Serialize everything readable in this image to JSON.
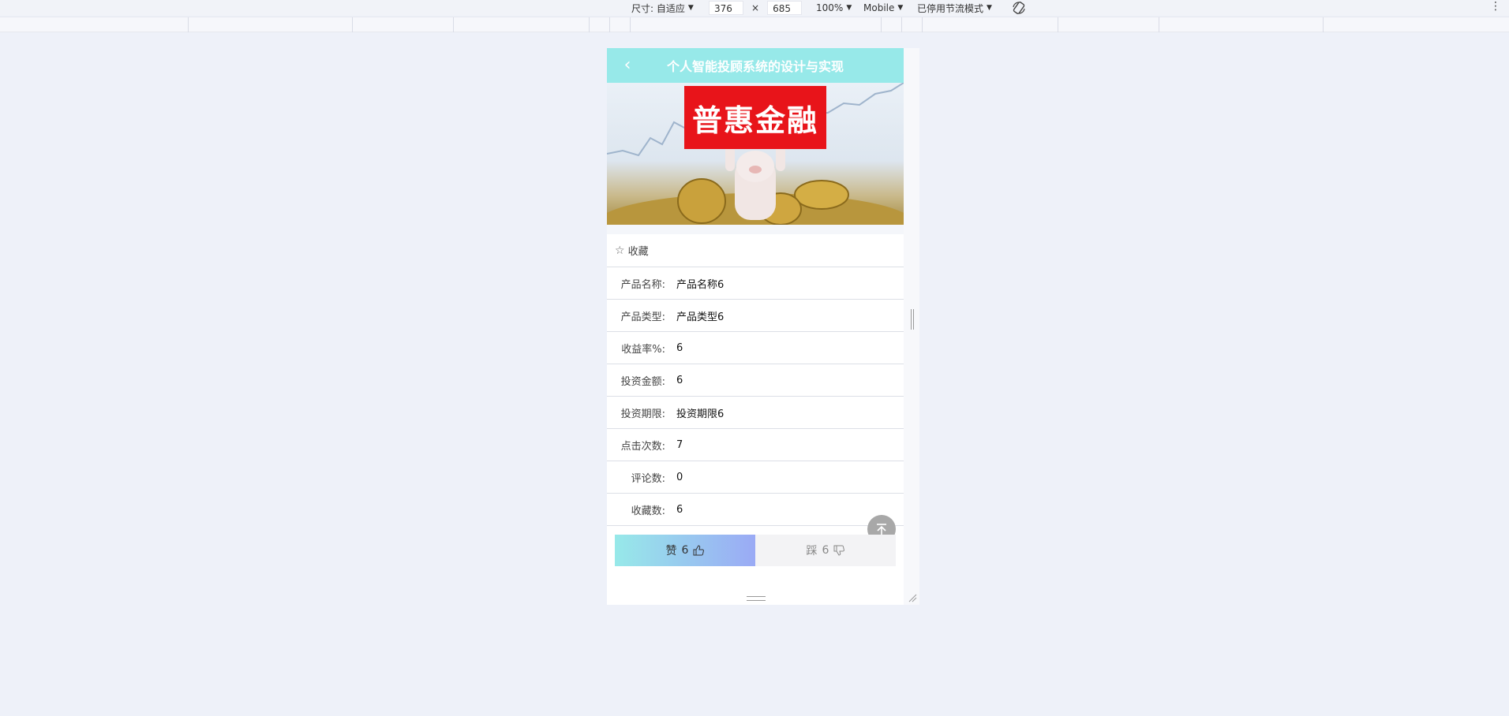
{
  "devtools": {
    "size_label": "尺寸: 自适应",
    "width": "376",
    "times": "×",
    "height": "685",
    "zoom": "100%",
    "device": "Mobile",
    "throttle": "已停用节流模式",
    "menu": "⋮"
  },
  "header": {
    "back_glyph": "‹",
    "title": "个人智能投顾系统的设计与实现"
  },
  "banner": {
    "sign_text": "普惠金融"
  },
  "favorite": {
    "star": "☆",
    "label": "收藏"
  },
  "details": [
    {
      "label": "产品名称:",
      "value": "产品名称6"
    },
    {
      "label": "产品类型:",
      "value": "产品类型6"
    },
    {
      "label": "收益率%:",
      "value": "6"
    },
    {
      "label": "投资金额:",
      "value": "6"
    },
    {
      "label": "投资期限:",
      "value": "投资期限6"
    },
    {
      "label": "点击次数:",
      "value": "7"
    },
    {
      "label": "评论数:",
      "value": "0"
    },
    {
      "label": "收藏数:",
      "value": "6"
    }
  ],
  "actions": {
    "like_label": "赞",
    "like_count": "6",
    "dislike_label": "踩",
    "dislike_count": "6"
  },
  "colors": {
    "header": "#97e9e9",
    "like_gradient_end": "#9aaaf5",
    "sign_red": "#e8141a"
  }
}
